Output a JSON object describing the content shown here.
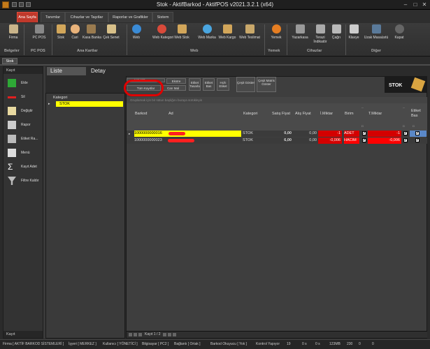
{
  "window": {
    "title": "Stok - AktifBarkod - AktifPOS v2021.3.2.1 (x64)"
  },
  "menu_tabs": [
    "Ana Sayfa",
    "Tanımlar",
    "Cihazlar ve Taşıtlar",
    "Raporlar ve Grafikler",
    "Sistem"
  ],
  "ribbon": {
    "buttons": [
      "Firma",
      "PC POS",
      "Stok",
      "Cari",
      "Kasa Banka",
      "Çek Senet",
      "Web",
      "Web Kategori",
      "Web Stok",
      "Web Marka",
      "Web Kargo",
      "Web Teslimat",
      "Yemek",
      "Yazarkasa",
      "Terazi İndikatör",
      "Çağrı",
      "Klavye",
      "Uzak Masaüstü",
      "Kapat"
    ],
    "groups": [
      "Belgeler",
      "PC POS",
      "Ana Kartlar",
      "Web",
      "Yemek",
      "Cihazlar",
      "Diğer"
    ]
  },
  "doc_tab": "Stok",
  "sidebar": {
    "header": "Kayıt",
    "items": [
      "Ekle",
      "Sil",
      "Değiştir",
      "Rapor",
      "Etiket Ra...",
      "Menü",
      "Kayıt Adet",
      "Filtre Kaldır"
    ],
    "footer": "Kayıt"
  },
  "view_tabs": [
    "Liste",
    "Detay"
  ],
  "kategori": {
    "header": "Kategori",
    "rows": [
      "STOK"
    ]
  },
  "toolbar": {
    "andart": "ANDART",
    "tum_kayitlar": "Tüm Kayıtlar",
    "ekstre": "Ekstre",
    "cari_mal": "Carı Mal",
    "etiket_tasarla": "Etiket Tasarla",
    "etiket_bas": "Etiket Bas",
    "hizli_etiket": "Hızlı Etiket",
    "cesit_goster": "Çeşit Göster",
    "cesit_matris": "Çeşit Matris Göster"
  },
  "logo": "STOK",
  "grid": {
    "hint": "Gruplamak için bir sütun başlığını buraya sürükleyin",
    "columns": [
      "Barkod",
      "Ad",
      "Kategori",
      "Satış Fiyat",
      "Alış Fiyat",
      "İ.Miktar",
      "Birim",
      "T.Miktar",
      "Etiket Bas"
    ],
    "rows": [
      {
        "barkod": "1000000000016",
        "kategori": "STOK",
        "satis": "0,00",
        "alis": "0,00",
        "imiktar": "-1",
        "birim": "ADET",
        "tmiktar": "-1"
      },
      {
        "barkod": "1000000000023",
        "kategori": "STOK",
        "satis": "6,00",
        "alis": "0,00",
        "imiktar": "-0,006",
        "birim": "HACIM",
        "tmiktar": "-0,006"
      }
    ]
  },
  "pager": {
    "text": "Kayıt 1 / 2"
  },
  "status": {
    "firma": "Firma [ AKTİF BARKOD SİSTEMLERİ ]",
    "isyeri": "İşyeri [ MERKEZ ]",
    "kullanici": "Kullanıcı [ YÖNETİCİ ]",
    "bilgisayar": "Bilgisayar [ PC2 ]",
    "baglanti": "Bağlantı [ Ortak ]",
    "barkod_okuyucu": "Barkod Okuyucu [ Yok ]",
    "kontrol": "Kontrol Yapıyor",
    "n1": "19",
    "n2": "0 s",
    "n3": "0 s",
    "mem": "123MB",
    "n4": "230",
    "n5": "0",
    "n6": "0"
  }
}
